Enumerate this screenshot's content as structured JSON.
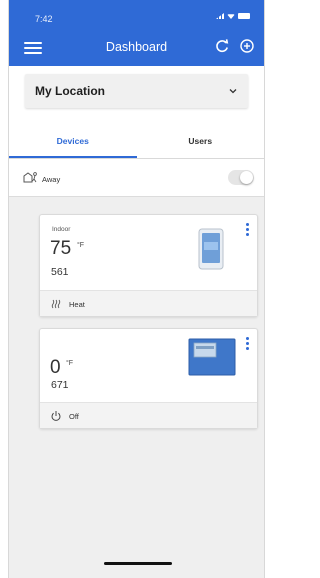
{
  "status_bar": {
    "time": "7:42"
  },
  "header": {
    "title": "Dashboard",
    "bg_color": "#2f6ad6"
  },
  "location": {
    "label": "My Location"
  },
  "tabs": [
    {
      "label": "Devices",
      "active": true
    },
    {
      "label": "Users",
      "active": false
    }
  ],
  "away": {
    "label": "Away",
    "toggle_on": false
  },
  "devices": [
    {
      "name": "Indoor",
      "temperature": "75",
      "unit": "°F",
      "value": "561",
      "mode_label": "Heat",
      "mode_icon": "heat-icon"
    },
    {
      "name": "",
      "temperature": "0",
      "unit": "°F",
      "value": "671",
      "mode_label": "Off",
      "mode_icon": "power-icon"
    }
  ]
}
